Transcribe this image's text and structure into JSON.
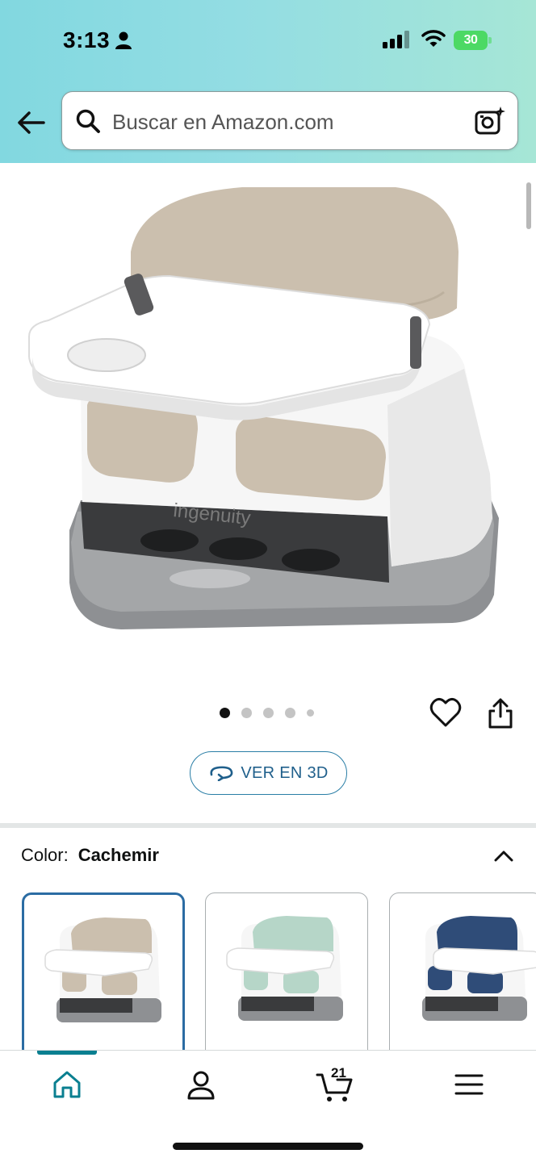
{
  "status_bar": {
    "time": "3:13",
    "battery": "30"
  },
  "search": {
    "placeholder": "Buscar en Amazon.com"
  },
  "product": {
    "brand_logo_text": "ingenuity",
    "image_count": 5,
    "active_image_index": 0,
    "view_3d_label": "VER EN 3D"
  },
  "color_selector": {
    "label": "Color:",
    "selected_value": "Cachemir",
    "swatches": [
      {
        "name": "cachemir",
        "seat_color": "#cbbfae",
        "selected": true
      },
      {
        "name": "mint",
        "seat_color": "#b6d6c8",
        "selected": false
      },
      {
        "name": "navy",
        "seat_color": "#2f4c78",
        "selected": false
      }
    ]
  },
  "bottom_nav": {
    "items": [
      "home-icon",
      "account-icon",
      "cart-icon",
      "menu-icon"
    ],
    "active": "home-icon",
    "cart_count": "21"
  },
  "colors": {
    "accent_teal": "#0a7f90",
    "link_blue": "#1f5f8b",
    "selected_border": "#2b6ca3"
  }
}
